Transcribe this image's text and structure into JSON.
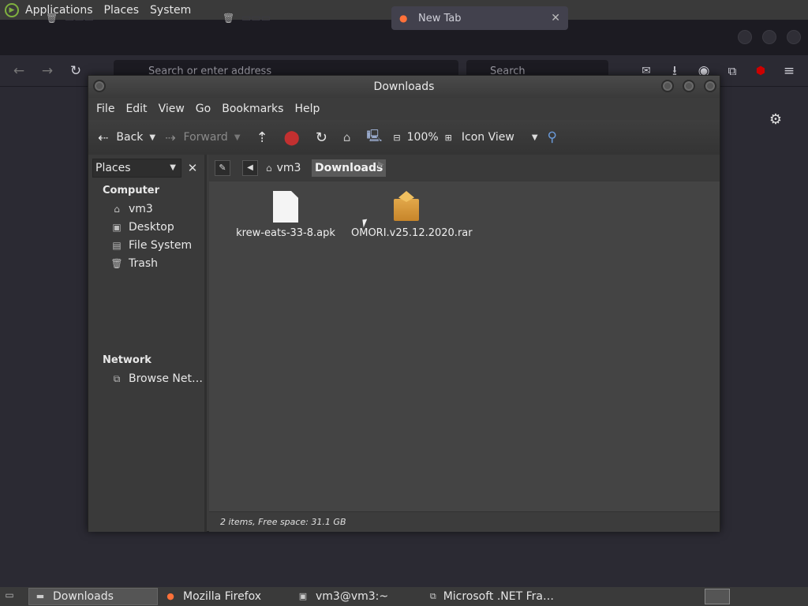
{
  "top_panel": {
    "menus": [
      "Applications",
      "Places",
      "System"
    ]
  },
  "firefox": {
    "active_tab_title": "New Tab",
    "urlbar_placeholder": "Search or enter address",
    "search_placeholder": "Search"
  },
  "caja": {
    "window_title": "Downloads",
    "menubar": [
      "File",
      "Edit",
      "View",
      "Go",
      "Bookmarks",
      "Help"
    ],
    "toolbar": {
      "back": "Back",
      "forward": "Forward",
      "zoom": "100%",
      "view_mode": "Icon View"
    },
    "sidebar": {
      "selector": "Places",
      "sections": [
        {
          "title": "Computer",
          "items": [
            "vm3",
            "Desktop",
            "File System",
            "Trash"
          ]
        },
        {
          "title": "Network",
          "items": [
            "Browse Net…"
          ]
        }
      ]
    },
    "path": [
      "vm3",
      "Downloads"
    ],
    "files": [
      {
        "name": "krew-eats-33-8.apk",
        "icon": "document-icon"
      },
      {
        "name": "OMORI.v25.12.2020.rar",
        "icon": "package-icon"
      }
    ],
    "status": "2 items, Free space: 31.1 GB"
  },
  "taskbar": {
    "tasks": [
      "Downloads",
      "Mozilla Firefox",
      "vm3@vm3:~",
      "Microsoft .NET Fra…"
    ]
  }
}
